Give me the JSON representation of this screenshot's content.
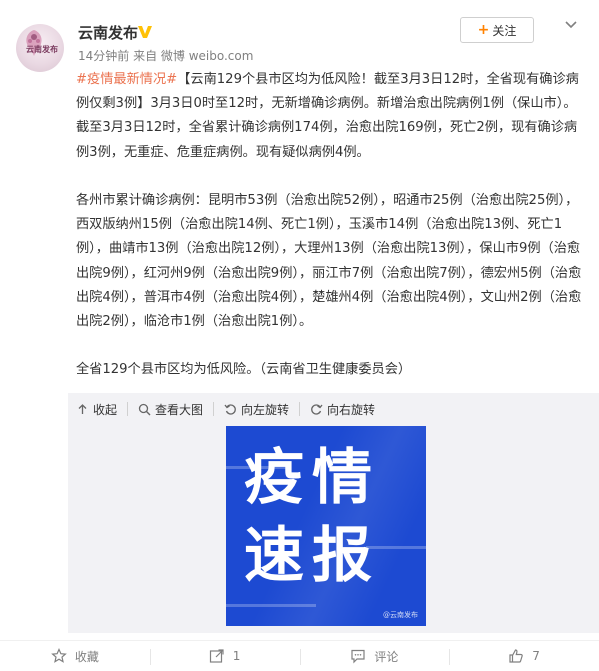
{
  "author": {
    "name": "云南发布",
    "avatar_text": "云南发布",
    "meta": "14分钟前 来自 微博 weibo.com"
  },
  "follow_button": {
    "plus": "+",
    "label": "关注"
  },
  "post": {
    "hashtag": "#疫情最新情况#",
    "paragraph1": "【云南129个县市区均为低风险！截至3月3日12时，全省现有确诊病例仅剩3例】3月3日0时至12时，无新增确诊病例。新增治愈出院病例1例（保山市）。截至3月3日12时，全省累计确诊病例174例，治愈出院169例，死亡2例，现有确诊病例3例，无重症、危重症病例。现有疑似病例4例。",
    "paragraph2": "各州市累计确诊病例：昆明市53例（治愈出院52例），昭通市25例（治愈出院25例），西双版纳州15例（治愈出院14例、死亡1例），玉溪市14例（治愈出院13例、死亡1例），曲靖市13例（治愈出院12例），大理州13例（治愈出院13例），保山市9例（治愈出院9例），红河州9例（治愈出院9例），丽江市7例（治愈出院7例），德宏州5例（治愈出院4例），普洱市4例（治愈出院4例），楚雄州4例（治愈出院4例），文山州2例（治愈出院2例），临沧市1例（治愈出院1例）。",
    "paragraph3": "全省129个县市区均为低风险。（云南省卫生健康委员会）"
  },
  "media_toolbar": {
    "collapse": "收起",
    "view_large": "查看大图",
    "rotate_left": "向左旋转",
    "rotate_right": "向右旋转"
  },
  "poster": {
    "line1": "疫情",
    "line2": "速报",
    "watermark": "@云南发布",
    "background": "#1d4ad2"
  },
  "footer": {
    "favorite": "收藏",
    "repost_count": "1",
    "comment": "评论",
    "like_count": "7"
  },
  "colors": {
    "hashtag": "#eb7350",
    "accent": "#ff8200",
    "verified": "#ffc107"
  }
}
